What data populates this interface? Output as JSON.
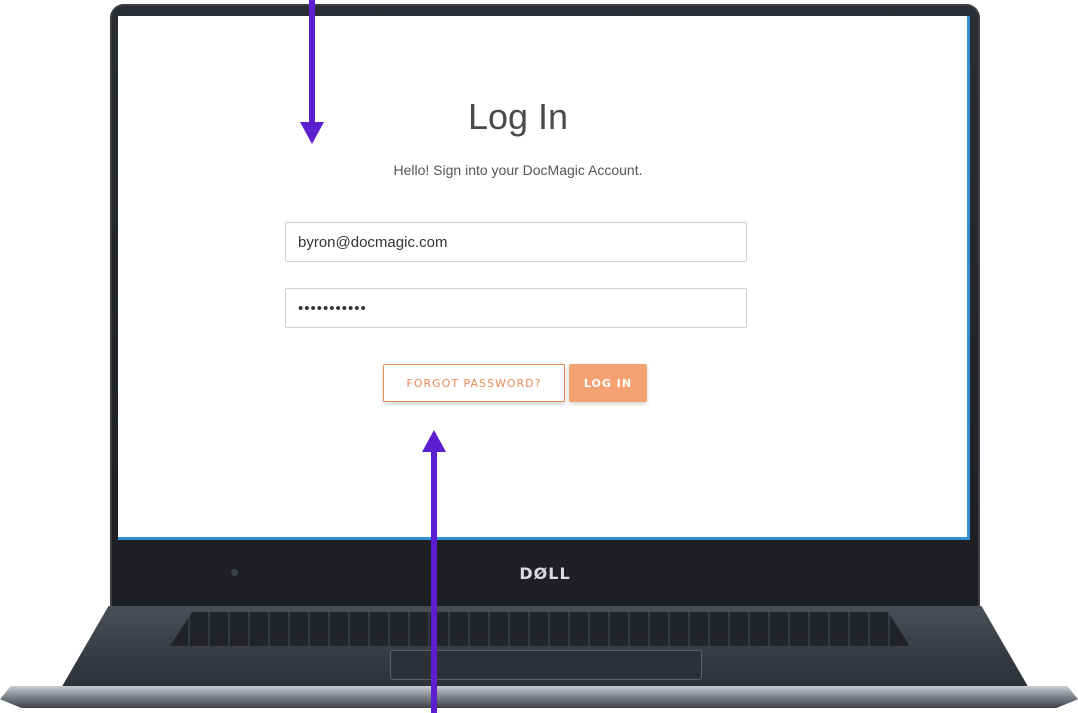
{
  "login": {
    "title": "Log In",
    "subtitle": "Hello! Sign into your DocMagic Account.",
    "email_value": "byron@docmagic.com",
    "password_value": "•••••••••••",
    "forgot_label": "FORGOT PASSWORD?",
    "login_label": "LOG IN"
  },
  "device": {
    "brand": "DØLL"
  },
  "colors": {
    "accent": "#f5a273",
    "accent_text": "#e98a5a",
    "annotation": "#5b1fd0",
    "screen_edge": "#2f8ed8"
  }
}
